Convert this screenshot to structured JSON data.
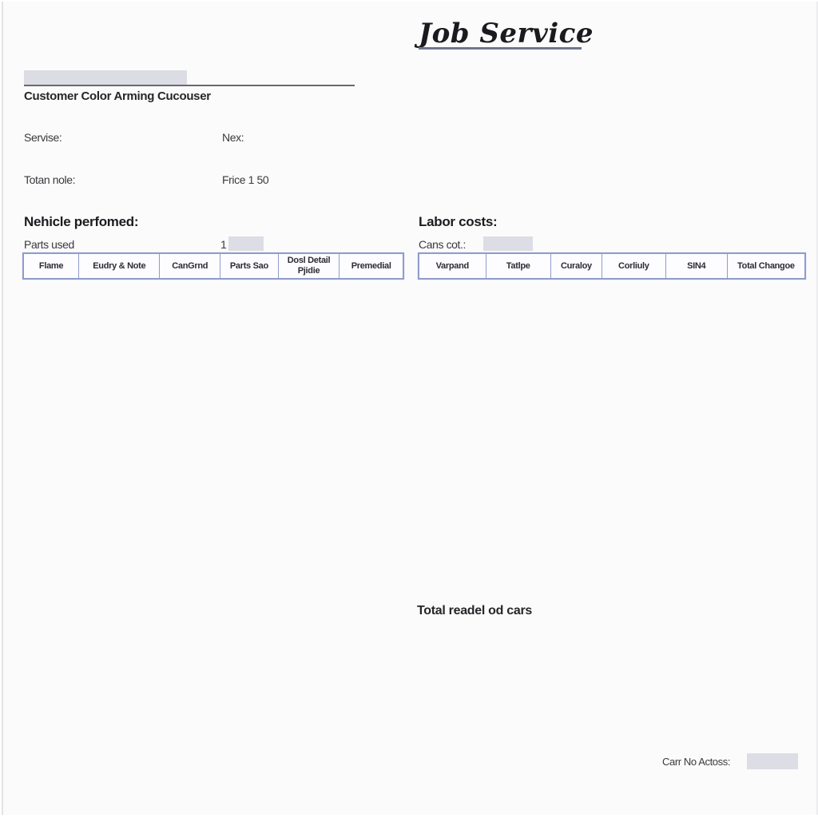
{
  "document": {
    "title": "Job Service",
    "customer_line": "Customer Color Arming Cucouser",
    "fields": {
      "service_label": "Servise:",
      "next_label": "Nex:",
      "total_label": "Totan nole:",
      "price_value": "Frice 1 50"
    },
    "parts_section": {
      "heading": "Nehicle perfomed:",
      "parts_label": "Parts used",
      "parts_count": "1",
      "columns": [
        "Flame",
        "Eudry & Note",
        "CanGrnd",
        "Parts Sao",
        "Dosl Detail Pjidie",
        "Premedial"
      ]
    },
    "labor_section": {
      "heading": "Labor costs:",
      "cost_label": "Cans cot.:",
      "columns": [
        "Varpand",
        "Tatlpe",
        "Curaloy",
        "Corliuly",
        "SIN4",
        "Total Changoe"
      ]
    },
    "total_line": "Total readel od cars",
    "footer": {
      "label": "Carr No Actoss:"
    }
  },
  "colors": {
    "table_border": "#8f9ccc",
    "fill_bar": "#dcdce5",
    "title_underline": "#6f7690"
  }
}
